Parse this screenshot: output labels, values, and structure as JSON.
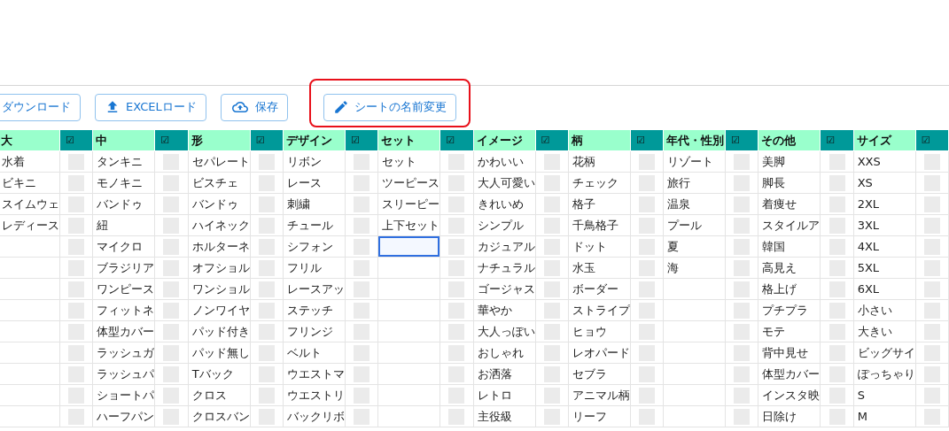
{
  "toolbar": {
    "buttons": [
      {
        "label": "ダウンロード",
        "kind": "download",
        "highlighted": false
      },
      {
        "label": "EXCELロード",
        "kind": "upload",
        "highlighted": false
      },
      {
        "label": "保存",
        "kind": "cloud",
        "highlighted": false
      },
      {
        "label": "シートの名前変更",
        "kind": "rename",
        "highlighted": true
      }
    ]
  },
  "table": {
    "columns": [
      {
        "header": "大",
        "check_header": "☑",
        "cells": [
          {
            "text": "水着",
            "checked": false,
            "selected": false
          },
          {
            "text": "ビキニ",
            "checked": false,
            "selected": false
          },
          {
            "text": "スイムウェ",
            "checked": false,
            "selected": false
          },
          {
            "text": "レディース",
            "checked": false,
            "selected": false
          },
          {
            "checked": false,
            "selected": false
          },
          {
            "checked": false,
            "selected": false
          },
          {
            "checked": false,
            "selected": false
          },
          {
            "checked": false,
            "selected": false
          },
          {
            "checked": false,
            "selected": false
          },
          {
            "checked": false,
            "selected": false
          },
          {
            "checked": false,
            "selected": false
          },
          {
            "checked": false,
            "selected": false
          },
          {
            "checked": false,
            "selected": false
          }
        ]
      },
      {
        "header": "中",
        "check_header": "☑",
        "cells": [
          {
            "text": "タンキニ",
            "checked": false,
            "selected": false
          },
          {
            "text": "モノキニ",
            "checked": false,
            "selected": false
          },
          {
            "text": "バンドゥ",
            "checked": false,
            "selected": false
          },
          {
            "text": "紐",
            "checked": false,
            "selected": false
          },
          {
            "text": "マイクロ",
            "checked": false,
            "selected": false
          },
          {
            "text": "ブラジリア",
            "checked": false,
            "selected": false
          },
          {
            "text": "ワンピース",
            "checked": false,
            "selected": false
          },
          {
            "text": "フィットネ",
            "checked": false,
            "selected": false
          },
          {
            "text": "体型カバー",
            "checked": false,
            "selected": false
          },
          {
            "text": "ラッシュガ",
            "checked": false,
            "selected": false
          },
          {
            "text": "ラッシュパ",
            "checked": false,
            "selected": false
          },
          {
            "text": "ショートパ",
            "checked": false,
            "selected": false
          },
          {
            "text": "ハーフパン",
            "checked": false,
            "selected": false
          }
        ]
      },
      {
        "header": "形",
        "check_header": "☑",
        "cells": [
          {
            "text": "セパレート",
            "checked": false,
            "selected": false
          },
          {
            "text": "ビスチェ",
            "checked": false,
            "selected": false
          },
          {
            "text": "バンドゥ",
            "checked": false,
            "selected": false
          },
          {
            "text": "ハイネック",
            "checked": false,
            "selected": false
          },
          {
            "text": "ホルターネ",
            "checked": false,
            "selected": false
          },
          {
            "text": "オフショル",
            "checked": false,
            "selected": false
          },
          {
            "text": "ワンショル",
            "checked": false,
            "selected": false
          },
          {
            "text": "ノンワイヤ",
            "checked": false,
            "selected": false
          },
          {
            "text": "パッド付き",
            "checked": false,
            "selected": false
          },
          {
            "text": "パッド無し",
            "checked": false,
            "selected": false
          },
          {
            "text": "Tバック",
            "checked": false,
            "selected": false
          },
          {
            "text": "クロス",
            "checked": false,
            "selected": false
          },
          {
            "text": "クロスバン",
            "checked": false,
            "selected": false
          }
        ]
      },
      {
        "header": "デザイン",
        "check_header": "☑",
        "cells": [
          {
            "text": "リボン",
            "checked": false,
            "selected": false
          },
          {
            "text": "レース",
            "checked": false,
            "selected": false
          },
          {
            "text": "刺繍",
            "checked": false,
            "selected": false
          },
          {
            "text": "チュール",
            "checked": false,
            "selected": false
          },
          {
            "text": "シフォン",
            "checked": false,
            "selected": false
          },
          {
            "text": "フリル",
            "checked": false,
            "selected": false
          },
          {
            "text": "レースアッ",
            "checked": false,
            "selected": false
          },
          {
            "text": "ステッチ",
            "checked": false,
            "selected": false
          },
          {
            "text": "フリンジ",
            "checked": false,
            "selected": false
          },
          {
            "text": "ベルト",
            "checked": false,
            "selected": false
          },
          {
            "text": "ウエストマ",
            "checked": false,
            "selected": false
          },
          {
            "text": "ウエストリ",
            "checked": false,
            "selected": false
          },
          {
            "text": "バックリボ",
            "checked": false,
            "selected": false
          }
        ]
      },
      {
        "header": "セット",
        "check_header": "☑",
        "cells": [
          {
            "text": "セット",
            "checked": false,
            "selected": false
          },
          {
            "text": "ツーピース",
            "checked": false,
            "selected": false
          },
          {
            "text": "スリーピー",
            "checked": false,
            "selected": false
          },
          {
            "text": "上下セット",
            "checked": false,
            "selected": false
          },
          {
            "checked": false,
            "selected": true
          },
          {
            "checked": false,
            "selected": false
          },
          {
            "checked": false,
            "selected": false
          },
          {
            "checked": false,
            "selected": false
          },
          {
            "checked": false,
            "selected": false
          },
          {
            "checked": false,
            "selected": false
          },
          {
            "checked": false,
            "selected": false
          },
          {
            "checked": false,
            "selected": false
          },
          {
            "checked": false,
            "selected": false
          }
        ]
      },
      {
        "header": "イメージ",
        "check_header": "☑",
        "cells": [
          {
            "text": "かわいい",
            "checked": false,
            "selected": false
          },
          {
            "text": "大人可愛い",
            "checked": false,
            "selected": false
          },
          {
            "text": "きれいめ",
            "checked": false,
            "selected": false
          },
          {
            "text": "シンプル",
            "checked": false,
            "selected": false
          },
          {
            "text": "カジュアル",
            "checked": false,
            "selected": false
          },
          {
            "text": "ナチュラル",
            "checked": false,
            "selected": false
          },
          {
            "text": "ゴージャス",
            "checked": false,
            "selected": false
          },
          {
            "text": "華やか",
            "checked": false,
            "selected": false
          },
          {
            "text": "大人っぽい",
            "checked": false,
            "selected": false
          },
          {
            "text": "おしゃれ",
            "checked": false,
            "selected": false
          },
          {
            "text": "お洒落",
            "checked": false,
            "selected": false
          },
          {
            "text": "レトロ",
            "checked": false,
            "selected": false
          },
          {
            "text": "主役級",
            "checked": false,
            "selected": false
          }
        ]
      },
      {
        "header": "柄",
        "check_header": "☑",
        "cells": [
          {
            "text": "花柄",
            "checked": false,
            "selected": false
          },
          {
            "text": "チェック",
            "checked": false,
            "selected": false
          },
          {
            "text": "格子",
            "checked": false,
            "selected": false
          },
          {
            "text": "千鳥格子",
            "checked": false,
            "selected": false
          },
          {
            "text": "ドット",
            "checked": false,
            "selected": false
          },
          {
            "text": "水玉",
            "checked": false,
            "selected": false
          },
          {
            "text": "ボーダー",
            "checked": false,
            "selected": false
          },
          {
            "text": "ストライプ",
            "checked": false,
            "selected": false
          },
          {
            "text": "ヒョウ",
            "checked": false,
            "selected": false
          },
          {
            "text": "レオパード",
            "checked": false,
            "selected": false
          },
          {
            "text": "セブラ",
            "checked": false,
            "selected": false
          },
          {
            "text": "アニマル柄",
            "checked": false,
            "selected": false
          },
          {
            "text": "リーフ",
            "checked": false,
            "selected": false
          }
        ]
      },
      {
        "header": "年代・性別",
        "check_header": "☑",
        "cells": [
          {
            "text": "リゾート",
            "checked": false,
            "selected": false
          },
          {
            "text": "旅行",
            "checked": false,
            "selected": false
          },
          {
            "text": "温泉",
            "checked": false,
            "selected": false
          },
          {
            "text": "プール",
            "checked": false,
            "selected": false
          },
          {
            "text": "夏",
            "checked": false,
            "selected": false
          },
          {
            "text": "海",
            "checked": false,
            "selected": false
          },
          {
            "checked": false,
            "selected": false
          },
          {
            "checked": false,
            "selected": false
          },
          {
            "checked": false,
            "selected": false
          },
          {
            "checked": false,
            "selected": false
          },
          {
            "checked": false,
            "selected": false
          },
          {
            "checked": false,
            "selected": false
          },
          {
            "checked": false,
            "selected": false
          }
        ]
      },
      {
        "header": "その他",
        "check_header": "☑",
        "cells": [
          {
            "text": "美脚",
            "checked": false,
            "selected": false
          },
          {
            "text": "脚長",
            "checked": false,
            "selected": false
          },
          {
            "text": "着痩せ",
            "checked": false,
            "selected": false
          },
          {
            "text": "スタイルア",
            "checked": false,
            "selected": false
          },
          {
            "text": "韓国",
            "checked": false,
            "selected": false
          },
          {
            "text": "高見え",
            "checked": false,
            "selected": false
          },
          {
            "text": "格上げ",
            "checked": false,
            "selected": false
          },
          {
            "text": "プチプラ",
            "checked": false,
            "selected": false
          },
          {
            "text": "モテ",
            "checked": false,
            "selected": false
          },
          {
            "text": "背中見せ",
            "checked": false,
            "selected": false
          },
          {
            "text": "体型カバー",
            "checked": false,
            "selected": false
          },
          {
            "text": "インスタ映",
            "checked": false,
            "selected": false
          },
          {
            "text": "日除け",
            "checked": false,
            "selected": false
          }
        ]
      },
      {
        "header": "サイズ",
        "check_header": "☑",
        "cells": [
          {
            "text": "XXS",
            "checked": false,
            "selected": false
          },
          {
            "text": "XS",
            "checked": false,
            "selected": false
          },
          {
            "text": "2XL",
            "checked": false,
            "selected": false
          },
          {
            "text": "3XL",
            "checked": false,
            "selected": false
          },
          {
            "text": "4XL",
            "checked": false,
            "selected": false
          },
          {
            "text": "5XL",
            "checked": false,
            "selected": false
          },
          {
            "text": "6XL",
            "checked": false,
            "selected": false
          },
          {
            "text": "小さい",
            "checked": false,
            "selected": false
          },
          {
            "text": "大きい",
            "checked": false,
            "selected": false
          },
          {
            "text": "ビッグサイ",
            "checked": false,
            "selected": false
          },
          {
            "text": "ぽっちゃり",
            "checked": false,
            "selected": false
          },
          {
            "text": "S",
            "checked": false,
            "selected": false
          },
          {
            "text": "M",
            "checked": false,
            "selected": false
          }
        ]
      }
    ]
  }
}
